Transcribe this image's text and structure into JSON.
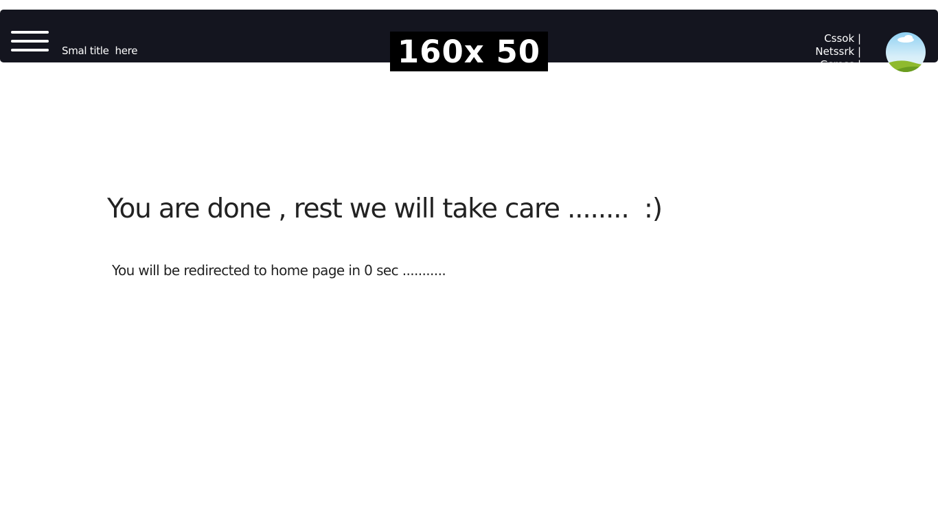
{
  "header": {
    "menu_icon": "hamburger-menu-icon",
    "small_title": "Smal title  here",
    "logo_text": "160x 50",
    "links": [
      "Cssok |",
      "Netssrk |",
      "Gsross |"
    ],
    "avatar_icon": "profile-avatar-icon",
    "background_color": "#14151f"
  },
  "main": {
    "headline": "You are done , rest we will take care ........  :)",
    "redirect_text": "You will be redirected to home page in 0 sec ..........."
  }
}
